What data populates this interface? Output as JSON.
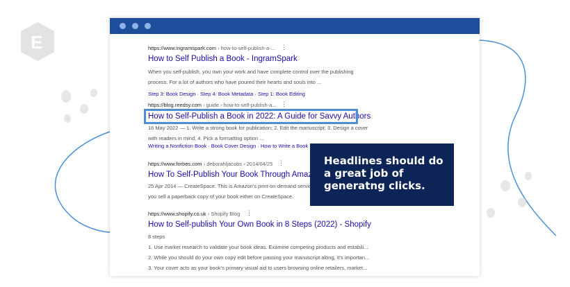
{
  "logo": {
    "letter": "E"
  },
  "results": [
    {
      "url": "https://www.ingramspark.com",
      "path": " › how-to-self-publish-a-...",
      "title": "How to Self Publish a Book - IngramSpark",
      "snippet": [
        "When you self-publish, you own your work and have complete control over the publishing",
        "process. For a lot of authors who have poured their hearts and souls into ..."
      ],
      "links": "Step 3: Book Design · Step 4: Book Metadata · Step 1: Book Editing"
    },
    {
      "url": "https://blog.reedsy.com",
      "path": " › guide › how-to-self-publish-a...",
      "title": "How to Self-Publish a Book in 2022: A Guide for Savvy Authors",
      "snippet": [
        "16 May 2022 — 1. Write a strong book for publication; 2. Edit the manuscript; 3. Design a cover",
        "with readers in mind; 4. Pick a formatting option ..."
      ],
      "links": "Writing a Nonfiction Book · Book Cover Design · How to Write a Book Proposal"
    },
    {
      "url": "https://www.forbes.com",
      "path": " › deborahljacobs › 2014/04/25",
      "title": "How To Self-Publish Your Book Through Amazon",
      "snippet": [
        "25 Apr 2014 — CreateSpace. This is Amazon's print-on-demand service",
        "you sell a paperback copy of your book either on CreateSpace."
      ]
    },
    {
      "url": "https://www.shopify.co.uk",
      "path": " › Shopify Blog",
      "title": "How to Self-publish Your Own Book in 8 Steps (2022) - Shopify",
      "snippet": [
        "8 steps",
        "1.  Use market research to validate your book ideas. Examine competing products and estabili...",
        "2.  While you should do your own copy edit before passing your manuscript along, it's importan...",
        "3.  Your cover acts as your book's primary visual aid to users browsing online retailers, market..."
      ]
    }
  ],
  "callout": "Headlines should do a great job of generatng clicks.",
  "colors": {
    "titlebar": "#1d4f9c",
    "callout": "#0d2457",
    "highlight": "#4b8fd6",
    "link": "#1a0dab"
  }
}
